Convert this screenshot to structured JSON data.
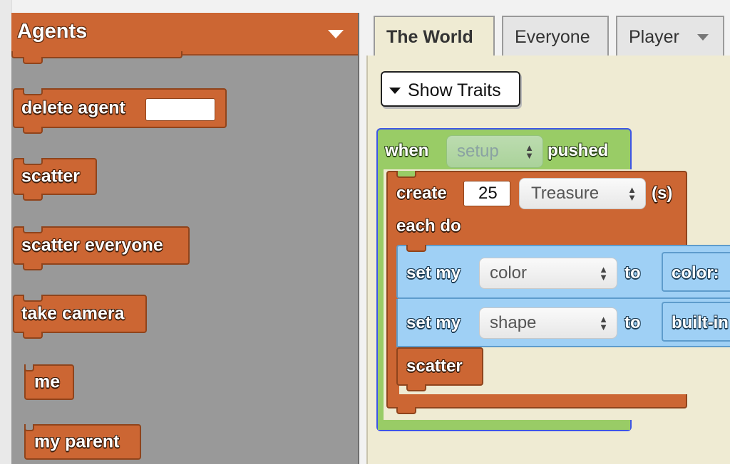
{
  "palette": {
    "title": "Agents",
    "blocks": [
      {
        "label": "delete agent"
      },
      {
        "label": "scatter"
      },
      {
        "label": "scatter everyone"
      },
      {
        "label": "take camera"
      },
      {
        "label": "me"
      },
      {
        "label": "my parent"
      }
    ]
  },
  "tabs": [
    {
      "label": "The World",
      "active": true
    },
    {
      "label": "Everyone",
      "active": false
    },
    {
      "label": "Player",
      "active": false
    }
  ],
  "show_traits_label": "Show Traits",
  "script": {
    "when_label": "when",
    "event": "setup",
    "pushed_label": "pushed",
    "create_label": "create",
    "create_count": "25",
    "create_breed": "Treasure",
    "create_suffix": "(s)",
    "each_do_label": "each do",
    "set1": {
      "label": "set my",
      "trait": "color",
      "to": "to",
      "value": "color:"
    },
    "set2": {
      "label": "set my",
      "trait": "shape",
      "to": "to",
      "value": "built-in"
    },
    "scatter_label": "scatter"
  },
  "colors": {
    "agents_block": "#cc6633",
    "event_block": "#99cc66",
    "traits_block": "#9fd0f5",
    "palette_bg": "#999999",
    "workspace_bg": "#efebd3"
  }
}
